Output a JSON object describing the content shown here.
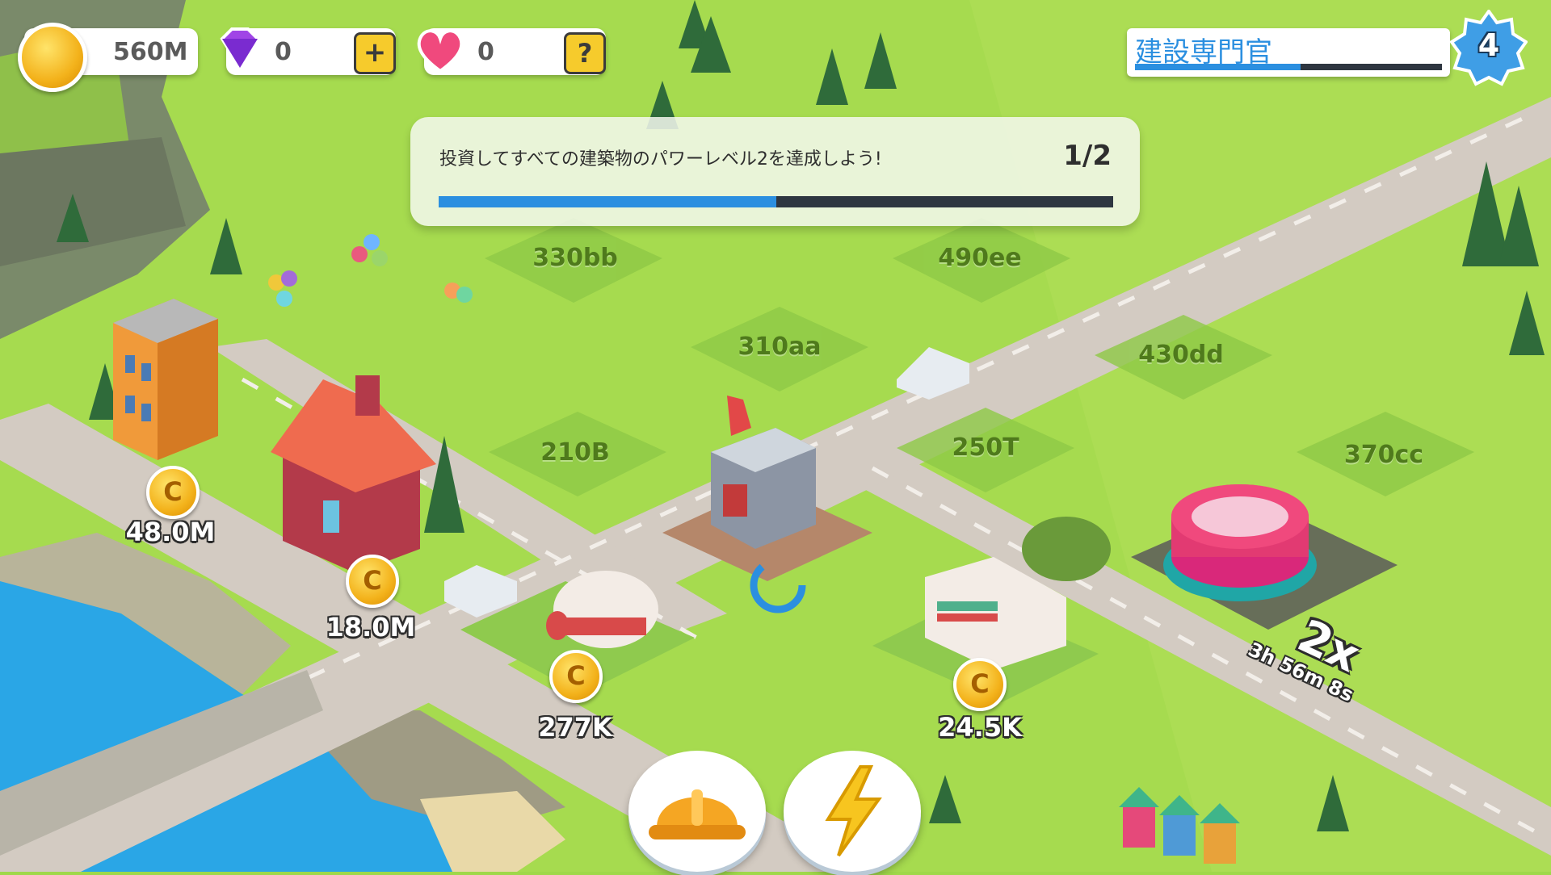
{
  "hud": {
    "coins": "560M",
    "gems": "0",
    "hearts": "0",
    "plus_icon": "plus-icon",
    "help_icon": "question-icon",
    "help_label": "?",
    "plus_label": "+"
  },
  "level": {
    "title": "建設専門官",
    "number": "4",
    "progress": 0.54
  },
  "quest": {
    "text": "投資してすべての建築物のパワーレベル2を達成しよう!",
    "count": "1/2",
    "progress": 0.5
  },
  "plots": [
    "330bb",
    "490ee",
    "310aa",
    "430dd",
    "210B",
    "250T",
    "370cc"
  ],
  "earnings": {
    "apartment": "48.0M",
    "red_house": "18.0M",
    "caravan": "277K",
    "rv": "24.5K"
  },
  "boost": {
    "multiplier": "2x",
    "timer": "3h 56m 8s"
  },
  "buttons": {
    "build_icon": "hardhat-icon",
    "boost_icon": "lightning-icon"
  },
  "coin_symbol": "C",
  "colors": {
    "grass": "#9fd84a",
    "road": "#d3cbc2",
    "water": "#2aa6e6",
    "progress_blue": "#2b8fe0",
    "coin_gold": "#f3b21b",
    "gem_purple": "#a045e6",
    "heart_pink": "#f0497d"
  }
}
